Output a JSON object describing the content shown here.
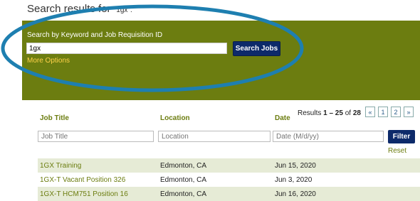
{
  "heading": {
    "prefix": "Search results for ",
    "query": "\"1gx\"."
  },
  "search": {
    "label": "Search by Keyword and Job Requisition ID",
    "value": "1gx",
    "button": "Search Jobs",
    "more_options": "More Options"
  },
  "results": {
    "prefix": "Results ",
    "range": "1 – 25",
    "of": " of ",
    "total": "28"
  },
  "pager": [
    "«",
    "1",
    "2",
    "»"
  ],
  "columns": {
    "title": "Job Title",
    "location": "Location",
    "date": "Date"
  },
  "filters": {
    "title_placeholder": "Job Title",
    "location_placeholder": "Location",
    "date_placeholder": "Date (M/d/yy)",
    "filter_button": "Filter",
    "reset": "Reset"
  },
  "rows": [
    {
      "title": "1GX Training",
      "location": "Edmonton, CA",
      "date": "Jun 15, 2020"
    },
    {
      "title": "1GX-T Vacant Position 326",
      "location": "Edmonton, CA",
      "date": "Jun 3, 2020"
    },
    {
      "title": "1GX-T HCM751 Position 16",
      "location": "Edmonton, CA",
      "date": "Jun 16, 2020"
    }
  ],
  "colors": {
    "panel": "#6c7d10",
    "button": "#0d2a6a",
    "highlight_ellipse": "#1e7fb0",
    "row_alt": "#e6ebd6"
  }
}
